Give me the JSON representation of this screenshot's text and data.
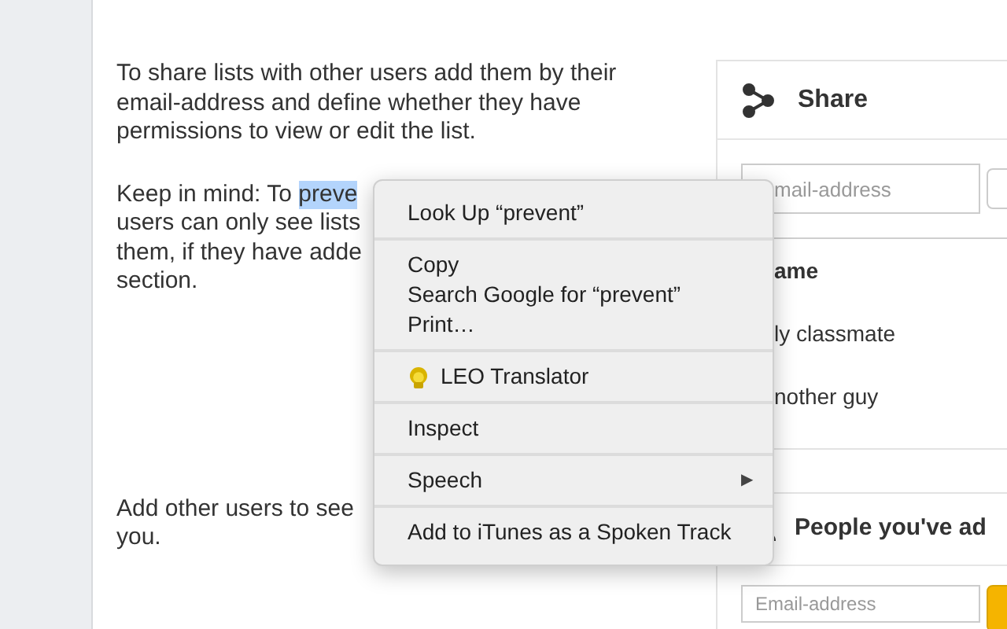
{
  "paragraphs": [
    {
      "lines": [
        {
          "text": "To share lists with other users add them by their"
        },
        {
          "text": "email-address and define whether they have"
        },
        {
          "text": "permissions to view or edit the list."
        }
      ]
    },
    {
      "lines": [
        {
          "text": "Keep in mind: To ",
          "selection": "preve"
        },
        {
          "text": "users can only see lists"
        },
        {
          "text": "them, if they have adde"
        },
        {
          "text": "section."
        }
      ]
    },
    {
      "lines": [
        {
          "text": "Add other users to see"
        },
        {
          "text": "you."
        }
      ]
    }
  ],
  "share_card": {
    "title": "Share",
    "email_placeholder": "mail-address",
    "column_header": "ame",
    "rows": [
      "ly classmate",
      "nother guy"
    ]
  },
  "people_card": {
    "title": "People you've ad",
    "email_placeholder": "Email-address"
  },
  "context_menu": {
    "groups": [
      [
        {
          "kind": "text",
          "label": "Look Up “prevent”"
        }
      ],
      [
        {
          "kind": "text",
          "label": "Copy"
        },
        {
          "kind": "text",
          "label": "Search Google for “prevent”"
        },
        {
          "kind": "text",
          "label": "Print…"
        }
      ],
      [
        {
          "kind": "icon",
          "label": "LEO Translator"
        }
      ],
      [
        {
          "kind": "text",
          "label": "Inspect"
        }
      ],
      [
        {
          "kind": "submenu",
          "label": "Speech",
          "arrow": "▶"
        }
      ],
      [
        {
          "kind": "text",
          "label": "Add to iTunes as a Spoken Track"
        }
      ]
    ]
  }
}
